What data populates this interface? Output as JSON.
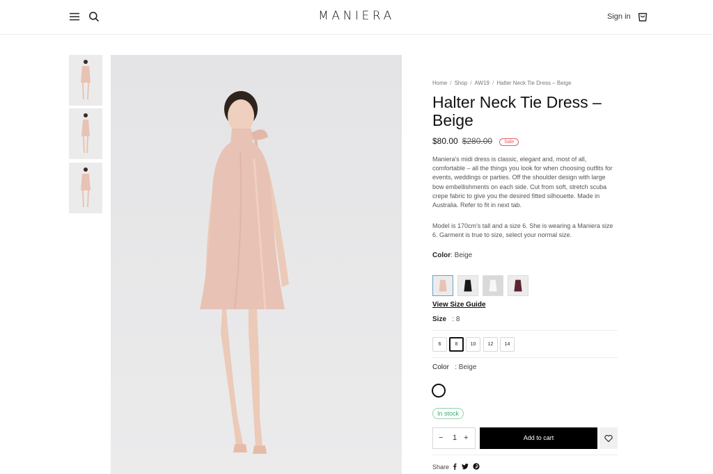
{
  "header": {
    "logo": "MANIERA",
    "sign_in": "Sign in"
  },
  "breadcrumb": [
    "Home",
    "Shop",
    "AW19",
    "Halter Neck Tie Dress – Beige"
  ],
  "product": {
    "title_line1": "Halter Neck Tie Dress –",
    "title_line2": "Beige",
    "price": "$80.00",
    "old_price": "$280.00",
    "badge": "Sale",
    "description": "Maniera's midi dress is classic, elegant and, most of all, comfortable – all the things you look for when choosing outfits for events, weddings or parties. Off the shoulder design with large bow embellishments on each side. Cut from soft, stretch scuba crepe fabric to give you the desired fitted silhouette. Made in Australia. Refer to fit in next tab.",
    "model_note": "Model is 170cm's tall and a size 6. She is wearing a Maniera size 6. Garment is true to size, select your normal size."
  },
  "color": {
    "label": "Color",
    "value": ": Beige",
    "swatches": [
      "beige",
      "black",
      "white",
      "maroon"
    ],
    "selected": "beige"
  },
  "size_guide": "View Size Guide",
  "size": {
    "label": "Size",
    "value": ": 8",
    "options": [
      "6",
      "8",
      "10",
      "12",
      "14"
    ],
    "selected": "8"
  },
  "color2": {
    "label": "Color",
    "value": ": Beige"
  },
  "stock": "In stock",
  "quantity": {
    "minus": "−",
    "value": "1",
    "plus": "+"
  },
  "add_to_cart": "Add to cart",
  "share_label": "Share",
  "colors": {
    "dress": "#e8c2b4",
    "accent_black": "#000000",
    "sale_red": "#e05a5a",
    "stock_green": "#3ea872"
  }
}
